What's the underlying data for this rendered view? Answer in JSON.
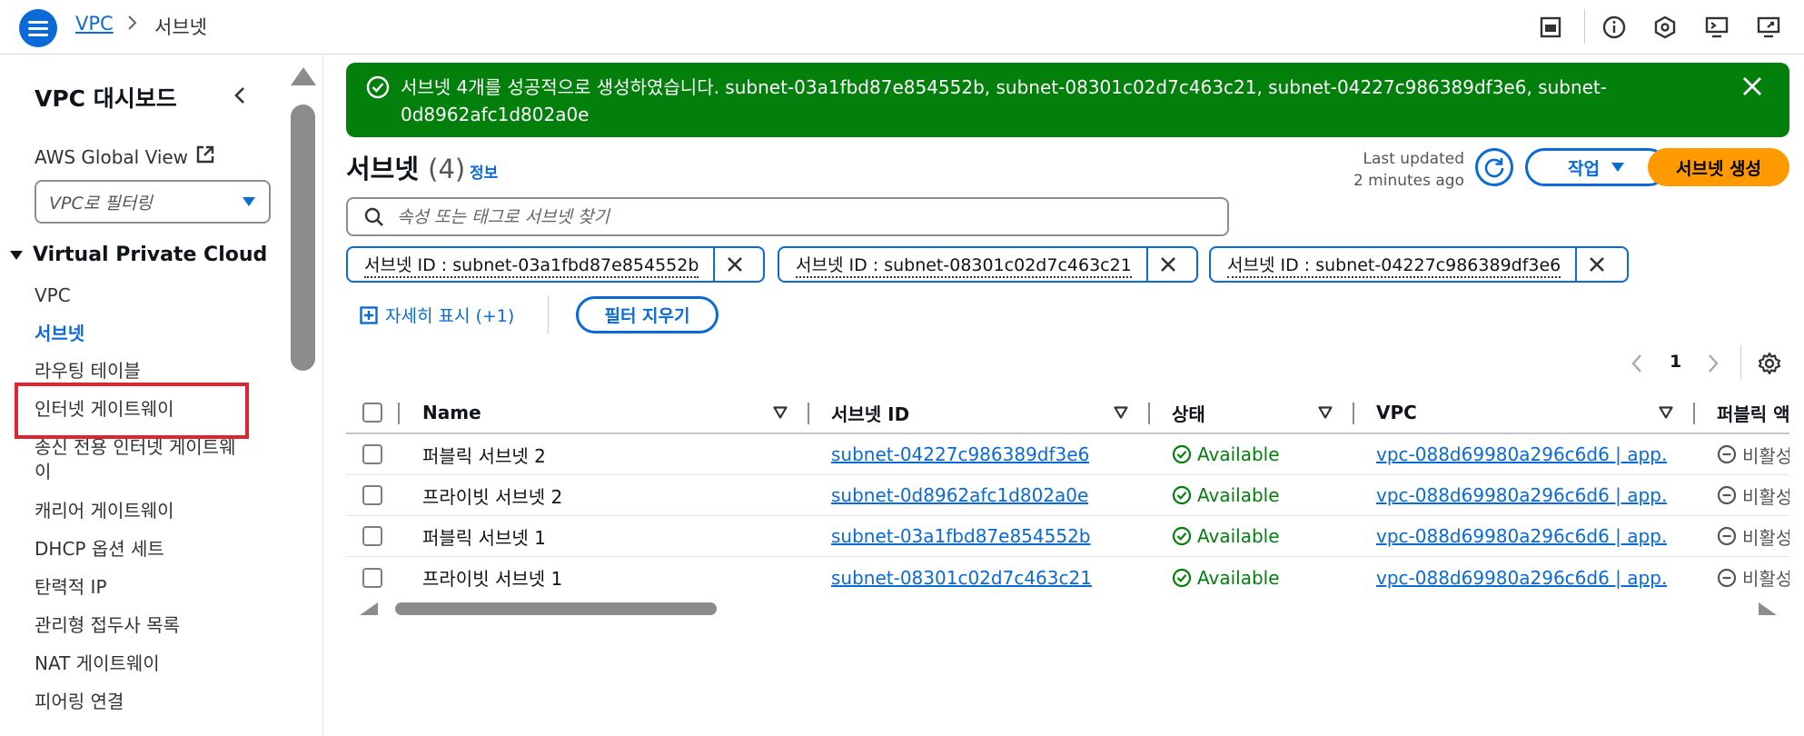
{
  "header": {
    "breadcrumb_root": "VPC",
    "breadcrumb_current": "서브넷"
  },
  "sidebar": {
    "title": "VPC 대시보드",
    "global_view": "AWS Global View",
    "filter_placeholder": "VPC로 필터링",
    "section": "Virtual Private Cloud",
    "items": [
      {
        "label": "VPC",
        "active": false
      },
      {
        "label": "서브넷",
        "active": true
      },
      {
        "label": "라우팅 테이블",
        "active": false
      },
      {
        "label": "인터넷 게이트웨이",
        "active": false
      },
      {
        "label": "송신 전용 인터넷 게이트웨",
        "active": false
      },
      {
        "label": "이",
        "active": false
      },
      {
        "label": "캐리어 게이트웨이",
        "active": false
      },
      {
        "label": "DHCP 옵션 세트",
        "active": false
      },
      {
        "label": "탄력적 IP",
        "active": false
      },
      {
        "label": "관리형 접두사 목록",
        "active": false
      },
      {
        "label": "NAT 게이트웨이",
        "active": false
      },
      {
        "label": "피어링 연결",
        "active": false
      }
    ]
  },
  "flash": {
    "message": "서브넷 4개를 성공적으로 생성하였습니다. subnet-03a1fbd87e854552b, subnet-08301c02d7c463c21, subnet-04227c986389df3e6, subnet-0d8962afc1d802a0e"
  },
  "main": {
    "title": "서브넷",
    "count": "(4)",
    "info": "정보",
    "updated_line1": "Last updated",
    "updated_line2": "2 minutes ago",
    "actions_label": "작업",
    "create_label": "서브넷 생성",
    "search_placeholder": "속성 또는 태그로 서브넷 찾기",
    "tokens": [
      "서브넷 ID : subnet-03a1fbd87e854552b",
      "서브넷 ID : subnet-08301c02d7c463c21",
      "서브넷 ID : subnet-04227c986389df3e6"
    ],
    "show_more": "자세히 표시 (+1)",
    "clear_filters": "필터 지우기",
    "page": "1"
  },
  "table": {
    "columns": [
      "Name",
      "서브넷 ID",
      "상태",
      "VPC",
      "퍼블릭 액"
    ],
    "rows": [
      {
        "name": "퍼블릭 서브넷 2",
        "subnet_id": "subnet-04227c986389df3e6",
        "status": "Available",
        "vpc": "vpc-088d69980a296c6d6 | app…",
        "public": "비활성"
      },
      {
        "name": "프라이빗 서브넷 2",
        "subnet_id": "subnet-0d8962afc1d802a0e",
        "status": "Available",
        "vpc": "vpc-088d69980a296c6d6 | app…",
        "public": "비활성"
      },
      {
        "name": "퍼블릭 서브넷 1",
        "subnet_id": "subnet-03a1fbd87e854552b",
        "status": "Available",
        "vpc": "vpc-088d69980a296c6d6 | app…",
        "public": "비활성"
      },
      {
        "name": "프라이빗 서브넷 1",
        "subnet_id": "subnet-08301c02d7c463c21",
        "status": "Available",
        "vpc": "vpc-088d69980a296c6d6 | app…",
        "public": "비활성"
      }
    ]
  },
  "colors": {
    "link": "#0a6ad8",
    "success": "#037f0c",
    "primary_button": "#ff9900",
    "highlight": "#e0242f"
  }
}
